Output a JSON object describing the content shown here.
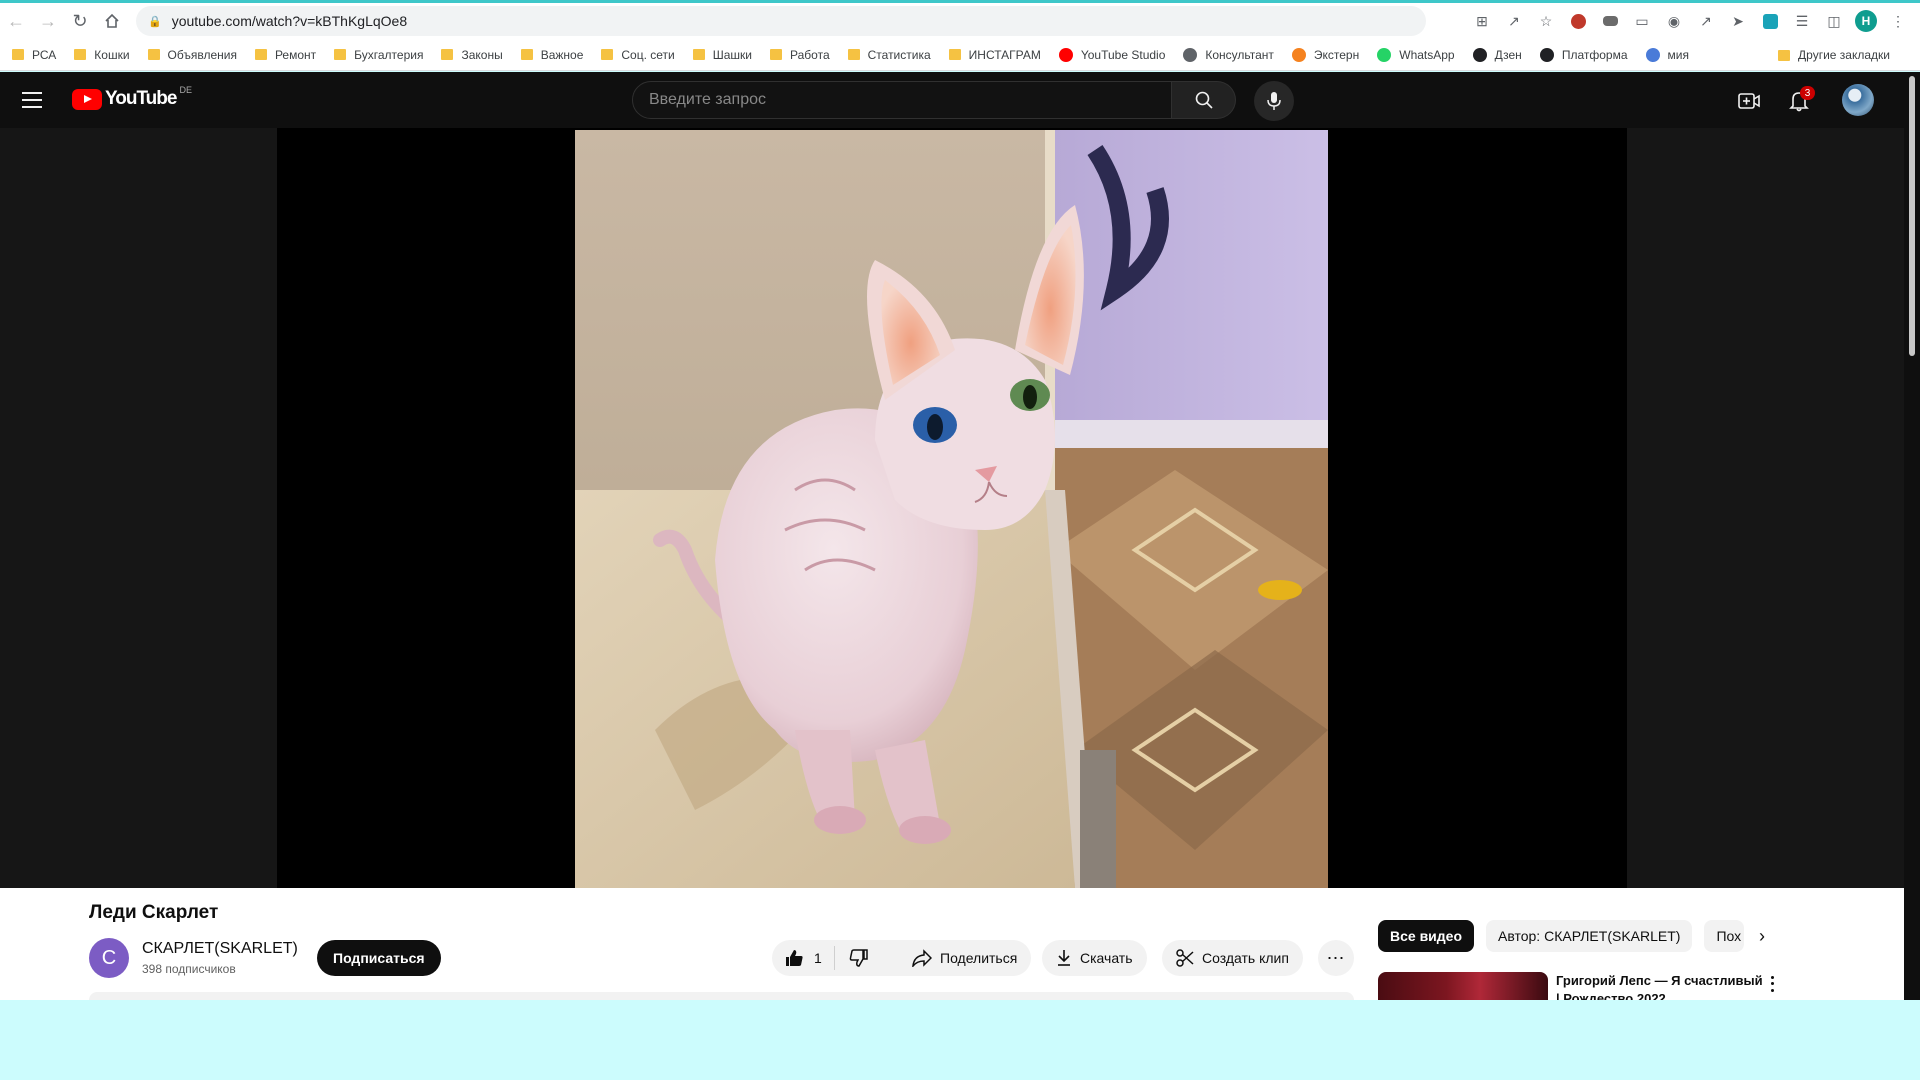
{
  "browser": {
    "url": "youtube.com/watch?v=kBThKgLqOe8",
    "bookmarks": [
      {
        "label": "РСА",
        "type": "folder"
      },
      {
        "label": "Кошки",
        "type": "folder"
      },
      {
        "label": "Объявления",
        "type": "folder"
      },
      {
        "label": "Ремонт",
        "type": "folder"
      },
      {
        "label": "Бухгалтерия",
        "type": "folder"
      },
      {
        "label": "Законы",
        "type": "folder"
      },
      {
        "label": "Важное",
        "type": "folder"
      },
      {
        "label": "Соц. сети",
        "type": "folder"
      },
      {
        "label": "Шашки",
        "type": "folder"
      },
      {
        "label": "Работа",
        "type": "folder"
      },
      {
        "label": "Статистика",
        "type": "folder"
      },
      {
        "label": "ИНСТАГРАМ",
        "type": "folder"
      },
      {
        "label": "YouTube Studio",
        "type": "youtube-studio-icon",
        "color": "#ff0000"
      },
      {
        "label": "Консультант",
        "type": "chat-icon",
        "color": "#5f6368"
      },
      {
        "label": "Экстерн",
        "type": "check-icon",
        "color": "#f5821f"
      },
      {
        "label": "WhatsApp",
        "type": "whatsapp-icon",
        "color": "#25d366"
      },
      {
        "label": "Дзен",
        "type": "dzen-icon",
        "color": "#202124"
      },
      {
        "label": "Платформа",
        "type": "platform-icon",
        "color": "#202124"
      },
      {
        "label": "мия",
        "type": "miya-icon",
        "color": "#4a7bd8"
      }
    ],
    "other_bookmarks": "Другие закладки",
    "profile_initial": "Н"
  },
  "youtube": {
    "logo_text": "YouTube",
    "country_code": "DE",
    "search_placeholder": "Введите запрос",
    "notifications_count": "3",
    "video": {
      "title": "Леди Скарлет",
      "channel_initial": "С",
      "channel_name": "СКАРЛЕТ(SKARLET)",
      "subscribers": "398 подписчиков",
      "subscribe_label": "Подписаться",
      "likes": "1",
      "share_label": "Поделиться",
      "download_label": "Скачать",
      "clip_label": "Создать клип"
    },
    "chips": [
      "Все видео",
      "Автор: СКАРЛЕТ(SKARLET)",
      "Пох"
    ],
    "recommendation": {
      "title": "Григорий Лепс — Я счастливый | Рождество 2022"
    }
  },
  "colors": {
    "accent": "#ff0000",
    "page_bg": "#0f0f0f",
    "bottom_band": "#ccfcfd"
  }
}
